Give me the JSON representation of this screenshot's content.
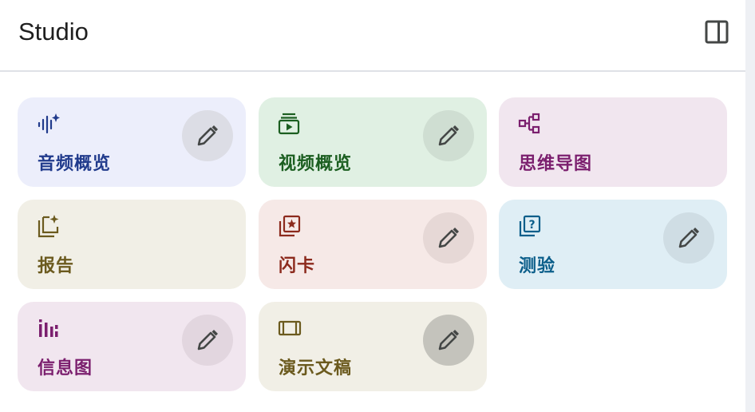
{
  "header": {
    "title": "Studio",
    "collapse_icon": "side-panel-icon"
  },
  "cards": [
    {
      "label": "音频概览",
      "icon": "audio-waveform-sparkle-icon",
      "bg": "#eceefb",
      "fg": "#213b8c",
      "edit": true,
      "edit_bg": "#dcdde5"
    },
    {
      "label": "视频概览",
      "icon": "video-playlist-icon",
      "bg": "#e0f0e3",
      "fg": "#1b5e20",
      "edit": true,
      "edit_bg": "#cfded2"
    },
    {
      "label": "思维导图",
      "icon": "mind-map-icon",
      "bg": "#f1e6ef",
      "fg": "#7b1f6e",
      "edit": false
    },
    {
      "label": "报告",
      "icon": "report-sparkle-icon",
      "bg": "#f1efe6",
      "fg": "#6b5a1e",
      "edit": false
    },
    {
      "label": "闪卡",
      "icon": "flashcards-icon",
      "bg": "#f6e9e7",
      "fg": "#8c2a1d",
      "edit": true,
      "edit_bg": "#e6d8d6"
    },
    {
      "label": "测验",
      "icon": "quiz-icon",
      "bg": "#dfeef5",
      "fg": "#0b5e8a",
      "edit": true,
      "edit_bg": "#cfdde4"
    },
    {
      "label": "信息图",
      "icon": "infographic-icon",
      "bg": "#f1e6ef",
      "fg": "#7b1f6e",
      "edit": true,
      "edit_bg": "#e2d6df"
    },
    {
      "label": "演示文稿",
      "icon": "slides-icon",
      "bg": "#f1efe6",
      "fg": "#6b5a1e",
      "edit": true,
      "edit_bg": "#c4c3bc"
    }
  ]
}
